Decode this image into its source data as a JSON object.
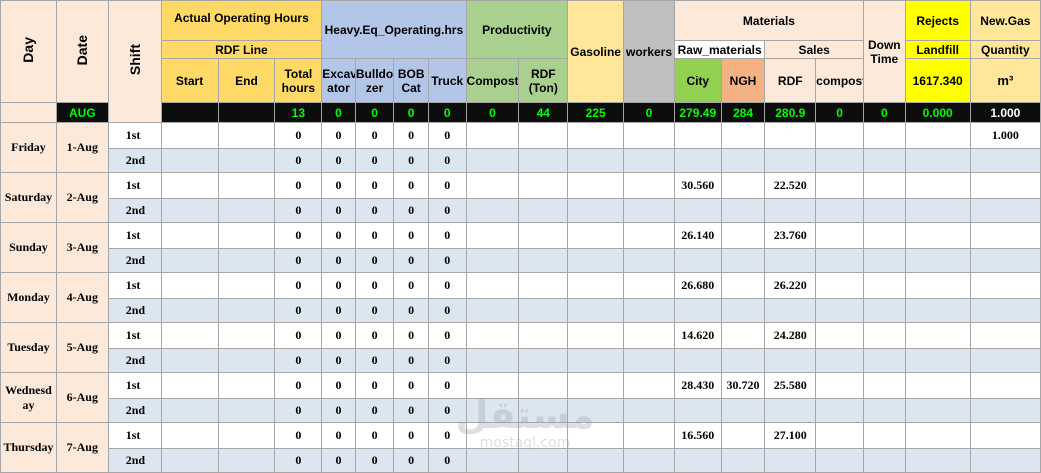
{
  "headers": {
    "day": "Day",
    "date": "Date",
    "shift": "Shift",
    "actual_operating_hours": "Actual Operating Hours",
    "rdf_line": "RDF Line",
    "start": "Start",
    "end": "End",
    "total_hours": "Total hours",
    "heavy_eq": "Heavy.Eq_Operating.hrs",
    "excavator": "Excav ator",
    "bulldozer": "Bulldo zer",
    "bobcat": "BOB Cat",
    "truck": "Truck",
    "productivity": "Productivity",
    "compost": "Compost",
    "rdf_ton": "RDF (Ton)",
    "gasoline": "Gasoline",
    "workers": "workers",
    "materials": "Materials",
    "raw_materials": "Raw_materials",
    "sales": "Sales",
    "city": "City",
    "ngh": "NGH",
    "rdf": "RDF",
    "compost_sales": "compost",
    "down_time": "Down Time",
    "rejects": "Rejects",
    "landfill": "Landfill",
    "landfill_value": "1617.340",
    "new_gas": "New.Gas",
    "quantity": "Quantity",
    "unit": "m³"
  },
  "totals": {
    "month": "AUG",
    "total_hours": "13",
    "excavator": "0",
    "bulldozer": "0",
    "bobcat": "0",
    "truck": "0",
    "compost": "0",
    "rdf_ton": "44",
    "gasoline": "225",
    "workers": "0",
    "city": "279.49",
    "ngh": "284",
    "rdf_sales": "280.9",
    "compost_sales": "0",
    "down_time": "0",
    "landfill": "0.000",
    "new_gas": "1.000"
  },
  "days": [
    {
      "day": "Friday",
      "date": "1-Aug",
      "shifts": [
        {
          "shift": "1st",
          "total": "0",
          "exc": "0",
          "bull": "0",
          "bob": "0",
          "truck": "0",
          "city": "",
          "ngh": "",
          "rdf": "",
          "gas": "1.000"
        },
        {
          "shift": "2nd",
          "total": "0",
          "exc": "0",
          "bull": "0",
          "bob": "0",
          "truck": "0",
          "city": "",
          "ngh": "",
          "rdf": "",
          "gas": ""
        }
      ]
    },
    {
      "day": "Saturday",
      "date": "2-Aug",
      "shifts": [
        {
          "shift": "1st",
          "total": "0",
          "exc": "0",
          "bull": "0",
          "bob": "0",
          "truck": "0",
          "city": "30.560",
          "ngh": "",
          "rdf": "22.520",
          "gas": ""
        },
        {
          "shift": "2nd",
          "total": "0",
          "exc": "0",
          "bull": "0",
          "bob": "0",
          "truck": "0",
          "city": "",
          "ngh": "",
          "rdf": "",
          "gas": ""
        }
      ]
    },
    {
      "day": "Sunday",
      "date": "3-Aug",
      "shifts": [
        {
          "shift": "1st",
          "total": "0",
          "exc": "0",
          "bull": "0",
          "bob": "0",
          "truck": "0",
          "city": "26.140",
          "ngh": "",
          "rdf": "23.760",
          "gas": ""
        },
        {
          "shift": "2nd",
          "total": "0",
          "exc": "0",
          "bull": "0",
          "bob": "0",
          "truck": "0",
          "city": "",
          "ngh": "",
          "rdf": "",
          "gas": ""
        }
      ]
    },
    {
      "day": "Monday",
      "date": "4-Aug",
      "shifts": [
        {
          "shift": "1st",
          "total": "0",
          "exc": "0",
          "bull": "0",
          "bob": "0",
          "truck": "0",
          "city": "26.680",
          "ngh": "",
          "rdf": "26.220",
          "gas": ""
        },
        {
          "shift": "2nd",
          "total": "0",
          "exc": "0",
          "bull": "0",
          "bob": "0",
          "truck": "0",
          "city": "",
          "ngh": "",
          "rdf": "",
          "gas": ""
        }
      ]
    },
    {
      "day": "Tuesday",
      "date": "5-Aug",
      "shifts": [
        {
          "shift": "1st",
          "total": "0",
          "exc": "0",
          "bull": "0",
          "bob": "0",
          "truck": "0",
          "city": "14.620",
          "ngh": "",
          "rdf": "24.280",
          "gas": ""
        },
        {
          "shift": "2nd",
          "total": "0",
          "exc": "0",
          "bull": "0",
          "bob": "0",
          "truck": "0",
          "city": "",
          "ngh": "",
          "rdf": "",
          "gas": ""
        }
      ]
    },
    {
      "day": "Wednesd ay",
      "date": "6-Aug",
      "shifts": [
        {
          "shift": "1st",
          "total": "0",
          "exc": "0",
          "bull": "0",
          "bob": "0",
          "truck": "0",
          "city": "28.430",
          "ngh": "30.720",
          "rdf": "25.580",
          "gas": ""
        },
        {
          "shift": "2nd",
          "total": "0",
          "exc": "0",
          "bull": "0",
          "bob": "0",
          "truck": "0",
          "city": "",
          "ngh": "",
          "rdf": "",
          "gas": ""
        }
      ]
    },
    {
      "day": "Thursday",
      "date": "7-Aug",
      "shifts": [
        {
          "shift": "1st",
          "total": "0",
          "exc": "0",
          "bull": "0",
          "bob": "0",
          "truck": "0",
          "city": "16.560",
          "ngh": "",
          "rdf": "27.100",
          "gas": ""
        },
        {
          "shift": "2nd",
          "total": "0",
          "exc": "0",
          "bull": "0",
          "bob": "0",
          "truck": "0",
          "city": "",
          "ngh": "",
          "rdf": "",
          "gas": ""
        }
      ]
    }
  ],
  "watermark": {
    "arabic": "مستقل",
    "latin": "mostaql.com"
  }
}
